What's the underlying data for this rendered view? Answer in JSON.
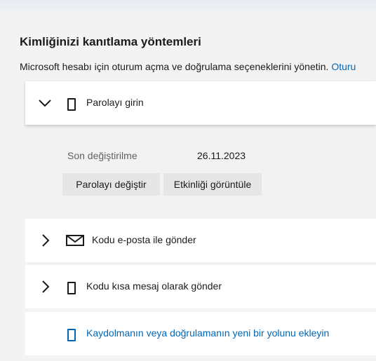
{
  "page": {
    "title": "Kimliğinizi kanıtlama yöntemleri",
    "subtitle": "Microsoft hesabı için oturum açma ve doğrulama seçeneklerini yönetin.",
    "subtitle_link": "Oturu"
  },
  "methods": {
    "password": {
      "label": "Parolayı girin",
      "expanded": true,
      "icon": "phone-outline-icon",
      "details": {
        "last_changed_label": "Son değiştirilme",
        "last_changed_value": "26.11.2023",
        "change_button": "Parolayı değiştir",
        "activity_button": "Etkinliği görüntüle"
      }
    },
    "email": {
      "label": "Kodu e-posta ile gönder",
      "expanded": false,
      "icon": "mail-icon"
    },
    "sms": {
      "label": "Kodu kısa mesaj olarak gönder",
      "expanded": false,
      "icon": "phone-outline-icon"
    },
    "add": {
      "label": "Kaydolmanın veya doğrulamanın yeni bir yolunu ekleyin",
      "icon": "phone-outline-icon"
    }
  },
  "colors": {
    "background": "#f3f3f3",
    "card": "#ffffff",
    "link": "#0067b8",
    "button": "#e6e6e6"
  }
}
